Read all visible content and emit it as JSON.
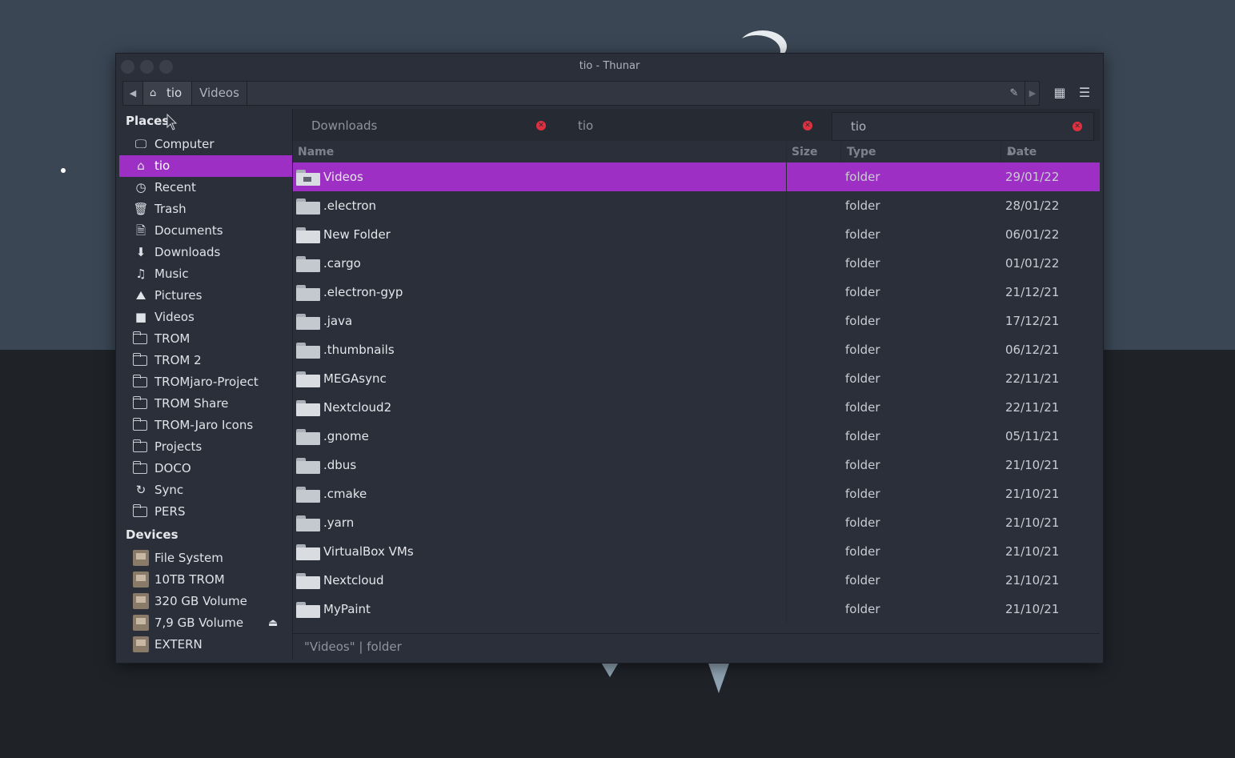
{
  "window": {
    "title": "tio - Thunar"
  },
  "pathbar": {
    "home_label": "tio",
    "current_label": "Videos"
  },
  "sidebar": {
    "places_header": "Places",
    "places": [
      {
        "label": "Computer",
        "icon": "computer-icon"
      },
      {
        "label": "tio",
        "icon": "home-icon",
        "selected": true
      },
      {
        "label": "Recent",
        "icon": "recent-icon"
      },
      {
        "label": "Trash",
        "icon": "trash-icon"
      },
      {
        "label": "Documents",
        "icon": "documents-icon"
      },
      {
        "label": "Downloads",
        "icon": "downloads-icon"
      },
      {
        "label": "Music",
        "icon": "music-icon"
      },
      {
        "label": "Pictures",
        "icon": "pictures-icon"
      },
      {
        "label": "Videos",
        "icon": "videos-icon"
      },
      {
        "label": "TROM",
        "icon": "folder-icon"
      },
      {
        "label": "TROM 2",
        "icon": "folder-icon"
      },
      {
        "label": "TROMjaro-Project",
        "icon": "folder-icon"
      },
      {
        "label": "TROM Share",
        "icon": "folder-icon"
      },
      {
        "label": "TROM-Jaro Icons",
        "icon": "folder-icon"
      },
      {
        "label": "Projects",
        "icon": "folder-icon"
      },
      {
        "label": "DOCO",
        "icon": "folder-icon"
      },
      {
        "label": "Sync",
        "icon": "sync-folder-icon"
      },
      {
        "label": "PERS",
        "icon": "folder-icon"
      }
    ],
    "devices_header": "Devices",
    "devices": [
      {
        "label": "File System",
        "icon": "drive-icon"
      },
      {
        "label": "10TB TROM",
        "icon": "drive-icon"
      },
      {
        "label": "320 GB Volume",
        "icon": "drive-icon"
      },
      {
        "label": "7,9 GB Volume",
        "icon": "drive-icon",
        "eject": true
      },
      {
        "label": "EXTERN",
        "icon": "drive-icon"
      }
    ]
  },
  "tabs": [
    {
      "label": "Downloads",
      "active": false
    },
    {
      "label": "tio",
      "active": false
    },
    {
      "label": "tio",
      "active": true
    }
  ],
  "columns": {
    "name": "Name",
    "size": "Size",
    "type": "Type",
    "date": "Date Modified",
    "sort_indicator": "▲"
  },
  "files": [
    {
      "name": "Videos",
      "type": "folder",
      "date": "29/01/22",
      "selected": true
    },
    {
      "name": ".electron",
      "type": "folder",
      "date": "28/01/22"
    },
    {
      "name": "New Folder",
      "type": "folder",
      "date": "06/01/22"
    },
    {
      "name": ".cargo",
      "type": "folder",
      "date": "01/01/22"
    },
    {
      "name": ".electron-gyp",
      "type": "folder",
      "date": "21/12/21"
    },
    {
      "name": ".java",
      "type": "folder",
      "date": "17/12/21"
    },
    {
      "name": ".thumbnails",
      "type": "folder",
      "date": "06/12/21"
    },
    {
      "name": "MEGAsync",
      "type": "folder",
      "date": "22/11/21"
    },
    {
      "name": "Nextcloud2",
      "type": "folder",
      "date": "22/11/21"
    },
    {
      "name": ".gnome",
      "type": "folder",
      "date": "05/11/21"
    },
    {
      "name": ".dbus",
      "type": "folder",
      "date": "21/10/21"
    },
    {
      "name": ".cmake",
      "type": "folder",
      "date": "21/10/21"
    },
    {
      "name": ".yarn",
      "type": "folder",
      "date": "21/10/21"
    },
    {
      "name": "VirtualBox VMs",
      "type": "folder",
      "date": "21/10/21"
    },
    {
      "name": "Nextcloud",
      "type": "folder",
      "date": "21/10/21"
    },
    {
      "name": "MyPaint",
      "type": "folder",
      "date": "21/10/21"
    }
  ],
  "statusbar": {
    "text": "\"Videos\" | folder"
  },
  "colors": {
    "accent": "#9d2fc4",
    "window_bg": "#2b2f3a",
    "tab_close": "#e0303f"
  }
}
